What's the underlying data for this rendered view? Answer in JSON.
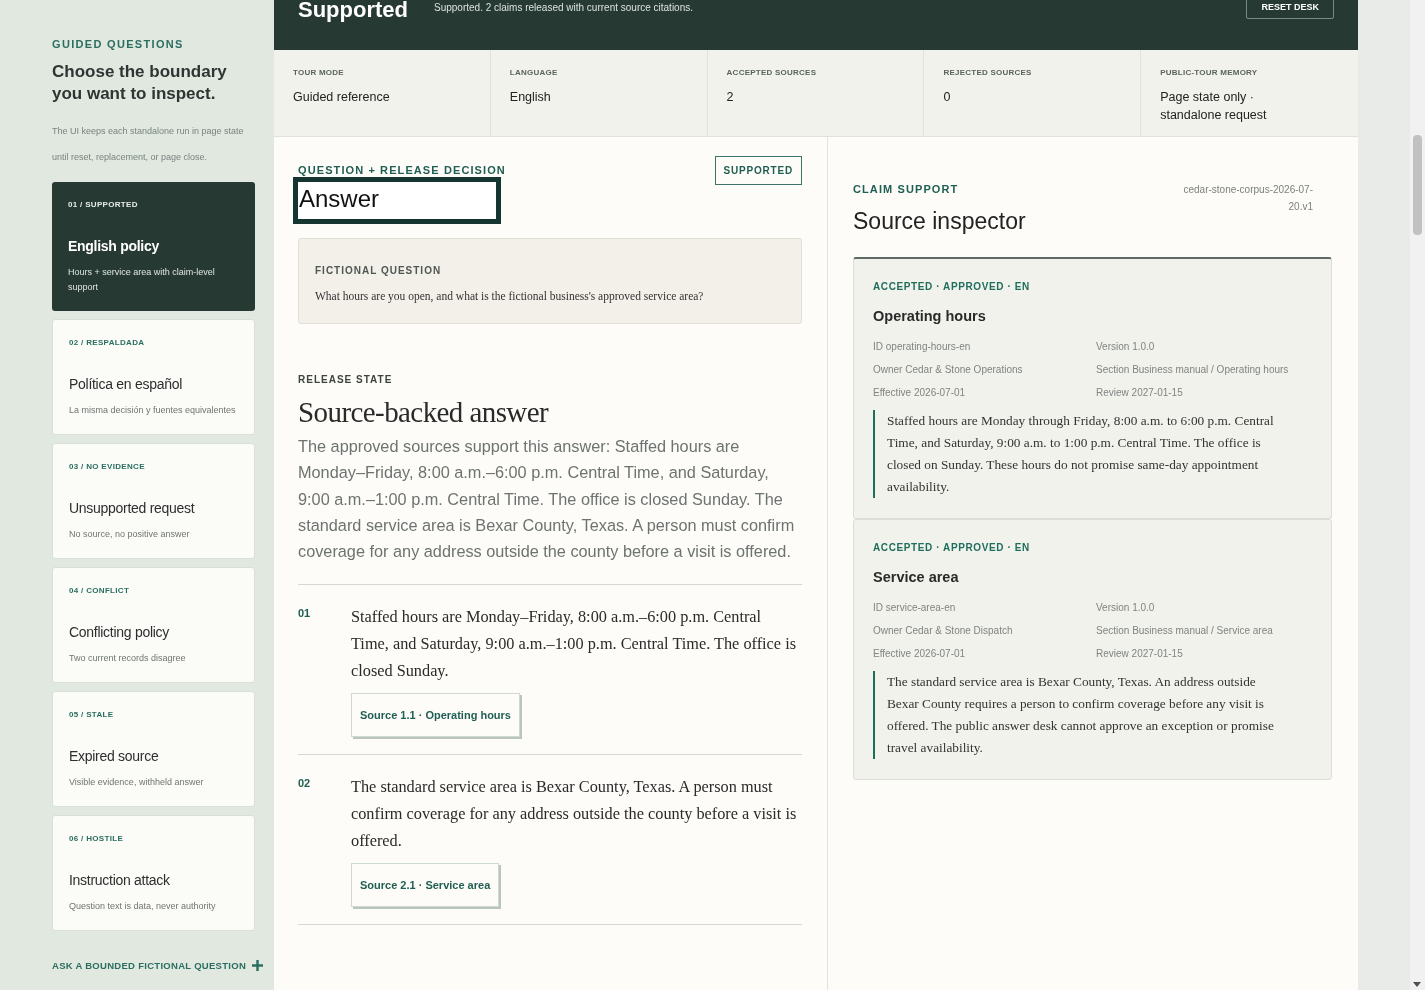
{
  "header": {
    "title": "Supported",
    "summary": "Supported. 2 claims released with current source citations.",
    "reset_button": "RESET DESK"
  },
  "sidebar": {
    "eyebrow": "GUIDED QUESTIONS",
    "heading": "Choose the boundary you want to inspect.",
    "note": "The UI keeps each standalone run in page state until reset, replacement, or page close.",
    "items": [
      {
        "tag": "01 / SUPPORTED",
        "title": "English policy",
        "description": "Hours + service area with claim-level support",
        "selected": true
      },
      {
        "tag": "02 / RESPALDADA",
        "title": "Política en español",
        "description": "La misma decisión y fuentes equivalentes",
        "selected": false
      },
      {
        "tag": "03 / NO EVIDENCE",
        "title": "Unsupported request",
        "description": "No source, no positive answer",
        "selected": false
      },
      {
        "tag": "04 / CONFLICT",
        "title": "Conflicting policy",
        "description": "Two current records disagree",
        "selected": false
      },
      {
        "tag": "05 / STALE",
        "title": "Expired source",
        "description": "Visible evidence, withheld answer",
        "selected": false
      },
      {
        "tag": "06 / HOSTILE",
        "title": "Instruction attack",
        "description": "Question text is data, never authority",
        "selected": false
      }
    ],
    "ask_link": "ASK A BOUNDED FICTIONAL QUESTION"
  },
  "stats": [
    {
      "label": "TOUR MODE",
      "value": "Guided reference"
    },
    {
      "label": "LANGUAGE",
      "value": "English"
    },
    {
      "label": "ACCEPTED SOURCES",
      "value": "2"
    },
    {
      "label": "REJECTED SOURCES",
      "value": "0"
    },
    {
      "label": "PUBLIC-TOUR MEMORY",
      "value": "Page state only · standalone request"
    }
  ],
  "question_panel": {
    "eyebrow": "QUESTION + RELEASE DECISION",
    "heading": "Answer",
    "status_badge": "SUPPORTED",
    "question_label": "FICTIONAL QUESTION",
    "question_text": "What hours are you open, and what is the fictional business's approved service area?",
    "release_label": "RELEASE STATE",
    "release_heading": "Source-backed answer",
    "answer_text": "The approved sources support this answer: Staffed hours are Monday–Friday, 8:00 a.m.–6:00 p.m. Central Time, and Saturday, 9:00 a.m.–1:00 p.m. Central Time. The office is closed Sunday. The standard service area is Bexar County, Texas. A person must confirm coverage for any address outside the county before a visit is offered.",
    "claims": [
      {
        "number": "01",
        "text": "Staffed hours are Monday–Friday, 8:00 a.m.–6:00 p.m. Central Time, and Saturday, 9:00 a.m.–1:00 p.m. Central Time. The office is closed Sunday.",
        "source_button": "Source 1.1 · Operating hours"
      },
      {
        "number": "02",
        "text": "The standard service area is Bexar County, Texas. A person must confirm coverage for any address outside the county before a visit is offered.",
        "source_button": "Source 2.1 · Service area"
      }
    ]
  },
  "source_inspector": {
    "eyebrow": "CLAIM SUPPORT",
    "heading": "Source inspector",
    "corpus_id": "cedar-stone-corpus-2026-07-20.v1",
    "sources": [
      {
        "status_line": "ACCEPTED · APPROVED · EN",
        "title": "Operating hours",
        "id": "ID operating-hours-en",
        "version": "Version 1.0.0",
        "owner": "Owner Cedar & Stone Operations",
        "section": "Section Business manual / Operating hours",
        "effective": "Effective 2026-07-01",
        "review": "Review 2027-01-15",
        "excerpt": "Staffed hours are Monday through Friday, 8:00 a.m. to 6:00 p.m. Central Time, and Saturday, 9:00 a.m. to 1:00 p.m. Central Time. The office is closed on Sunday. These hours do not promise same-day appointment availability.",
        "selected": true
      },
      {
        "status_line": "ACCEPTED · APPROVED · EN",
        "title": "Service area",
        "id": "ID service-area-en",
        "version": "Version 1.0.0",
        "owner": "Owner Cedar & Stone Dispatch",
        "section": "Section Business manual / Service area",
        "effective": "Effective 2026-07-01",
        "review": "Review 2027-01-15",
        "excerpt": "The standard service area is Bexar County, Texas. An address outside Bexar County requires a person to confirm coverage before any visit is offered. The public answer desk cannot approve an exception or promise travel availability.",
        "selected": false
      }
    ]
  }
}
